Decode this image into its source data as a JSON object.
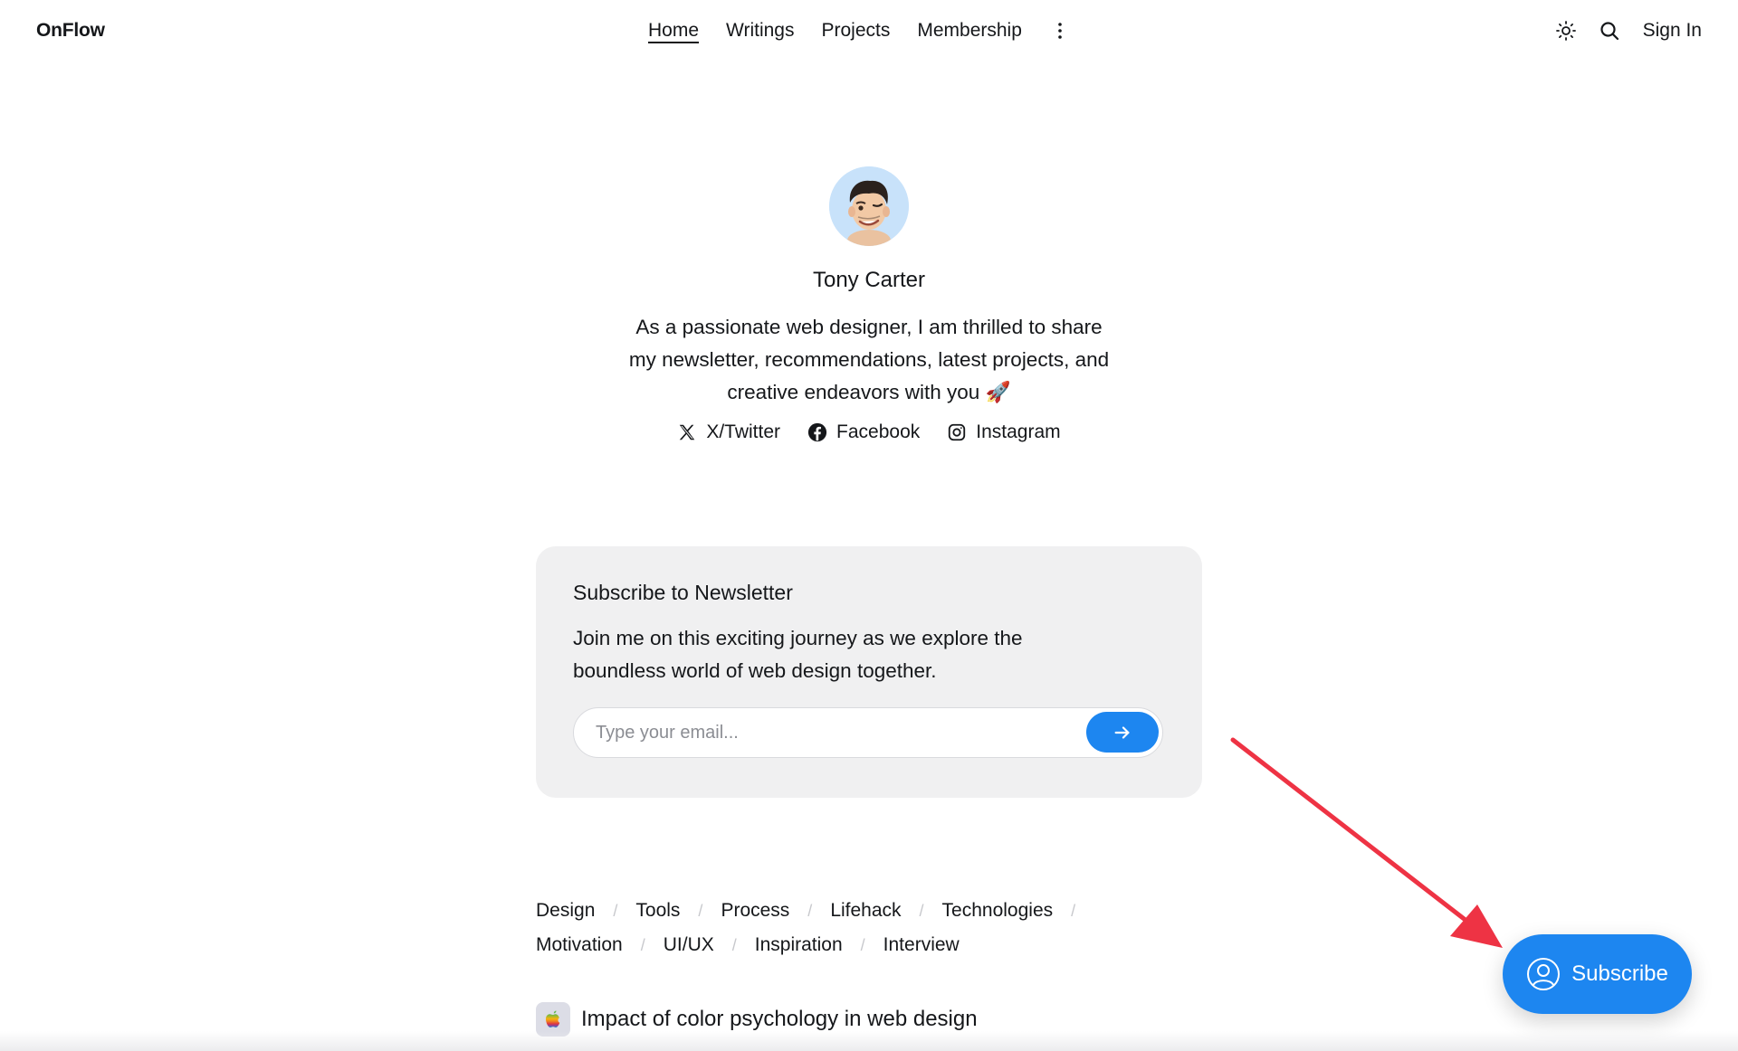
{
  "header": {
    "logo": "OnFlow",
    "nav": [
      {
        "label": "Home",
        "active": true
      },
      {
        "label": "Writings"
      },
      {
        "label": "Projects"
      },
      {
        "label": "Membership"
      }
    ],
    "more_icon": "vertical-dots-icon",
    "theme_icon": "sun-icon",
    "search_icon": "search-icon",
    "sign_in": "Sign In"
  },
  "profile": {
    "name": "Tony Carter",
    "bio_line1": "As a passionate web designer, I am thrilled to share",
    "bio_line2": "my newsletter, recommendations, latest projects, and",
    "bio_line3": "creative endeavors with you 🚀",
    "avatar_icon": "memoji-avatar",
    "socials": [
      {
        "label": "X/Twitter",
        "icon": "x-icon"
      },
      {
        "label": "Facebook",
        "icon": "facebook-icon"
      },
      {
        "label": "Instagram",
        "icon": "instagram-icon"
      }
    ]
  },
  "newsletter": {
    "title": "Subscribe to Newsletter",
    "desc_line1": "Join me on this exciting journey as we explore the",
    "desc_line2": "boundless world of web design together.",
    "email_placeholder": "Type your email...",
    "submit_icon": "arrow-right-icon"
  },
  "tags": {
    "row1": [
      "Design",
      "Tools",
      "Process",
      "Lifehack",
      "Technologies"
    ],
    "row2": [
      "Motivation",
      "UI/UX",
      "Inspiration",
      "Interview"
    ],
    "separator": "/"
  },
  "post": {
    "title": "Impact of color psychology in web design",
    "thumb_icon": "apple-logo-icon"
  },
  "subscribe_button": {
    "label": "Subscribe",
    "icon": "user-circle-icon"
  },
  "colors": {
    "accent": "#1d86f0",
    "card_bg": "#f0f0f1",
    "text": "#15171a",
    "annotation": "#ee3344"
  }
}
